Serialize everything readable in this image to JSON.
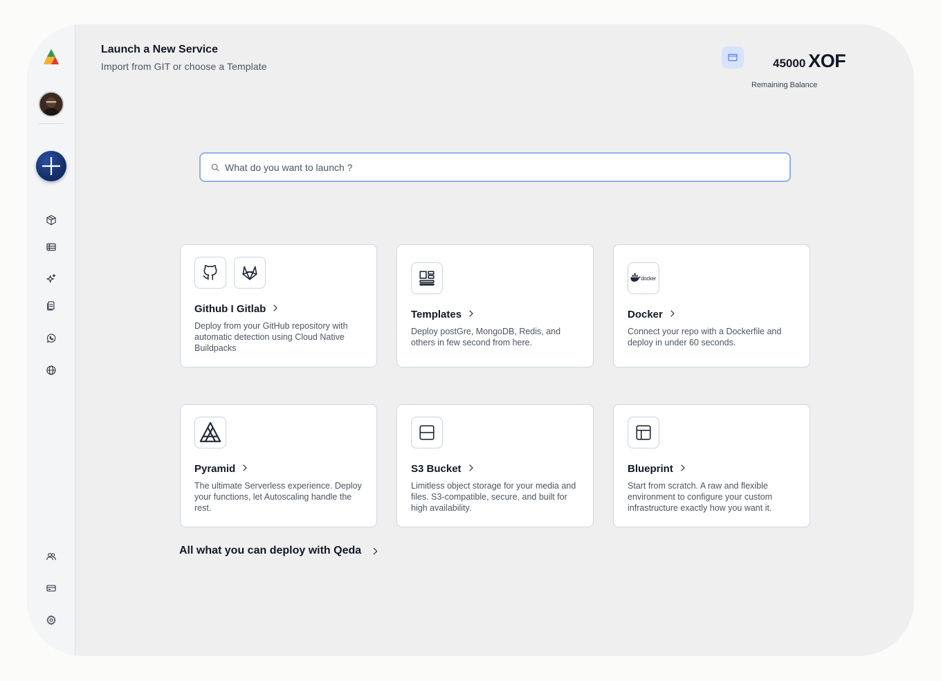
{
  "header": {
    "title": "Launch a New Service",
    "subtitle": "Import from GIT or choose a Template"
  },
  "balance": {
    "amount": "45000",
    "currency": "XOF",
    "label": "Remaining Balance",
    "icon": "wallet-icon"
  },
  "search": {
    "placeholder": "What do you want to launch ?",
    "value": ""
  },
  "sidebar": {
    "top_items": [
      {
        "icon": "cube-icon"
      },
      {
        "icon": "table-icon"
      },
      {
        "icon": "sparkles-icon"
      },
      {
        "icon": "documents-icon"
      },
      {
        "icon": "whatsapp-icon"
      },
      {
        "icon": "globe-icon"
      }
    ],
    "bottom_items": [
      {
        "icon": "users-icon"
      },
      {
        "icon": "credit-card-icon"
      },
      {
        "icon": "gear-icon"
      }
    ]
  },
  "cards": [
    {
      "title": "Github I Gitlab",
      "desc": "Deploy from your GitHub repository with automatic detection using Cloud Native Buildpacks",
      "icons": [
        "github-icon",
        "gitlab-icon"
      ]
    },
    {
      "title": "Templates",
      "desc": "Deploy postGre, MongoDB, Redis, and others in few second from here.",
      "icons": [
        "templates-icon"
      ]
    },
    {
      "title": "Docker",
      "desc": "Connect your repo with a Dockerfile and deploy in under 60 seconds.",
      "icons": [
        "docker-icon"
      ],
      "logo_text": "docker"
    },
    {
      "title": "Pyramid",
      "desc": "The ultimate Serverless experience. Deploy your functions, let Autoscaling handle the rest.",
      "icons": [
        "pyramid-icon"
      ]
    },
    {
      "title": "S3 Bucket",
      "desc": "Limitless object storage for your media and files. S3-compatible, secure, and built for high availability.",
      "icons": [
        "bucket-icon"
      ]
    },
    {
      "title": "Blueprint",
      "desc": "Start from scratch. A raw and flexible environment to configure your custom infrastructure exactly how you want it.",
      "icons": [
        "blueprint-icon"
      ]
    }
  ],
  "deploy_link": "All what you can deploy with Qeda",
  "colors": {
    "accent": "#8fb1ee",
    "new_button": "#15306a",
    "wallet_bg": "#d6e3fb"
  }
}
